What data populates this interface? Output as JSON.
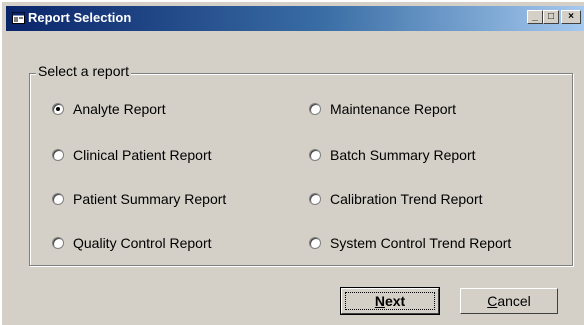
{
  "window": {
    "title": "Report Selection",
    "controls": {
      "minimize": "_",
      "maximize": "□",
      "close": "×"
    }
  },
  "group": {
    "legend": "Select a report",
    "options": [
      {
        "label": "Analyte Report",
        "checked": true
      },
      {
        "label": "Clinical Patient Report",
        "checked": false
      },
      {
        "label": "Patient Summary Report",
        "checked": false
      },
      {
        "label": "Quality Control Report",
        "checked": false
      },
      {
        "label": "Maintenance Report",
        "checked": false
      },
      {
        "label": "Batch Summary Report",
        "checked": false
      },
      {
        "label": "Calibration Trend Report",
        "checked": false
      },
      {
        "label": "System Control Trend Report",
        "checked": false
      }
    ]
  },
  "buttons": {
    "next": {
      "mnemonic": "N",
      "rest": "ext"
    },
    "cancel": {
      "mnemonic": "C",
      "rest": "ancel"
    }
  },
  "icons": {
    "window": "window-icon"
  }
}
